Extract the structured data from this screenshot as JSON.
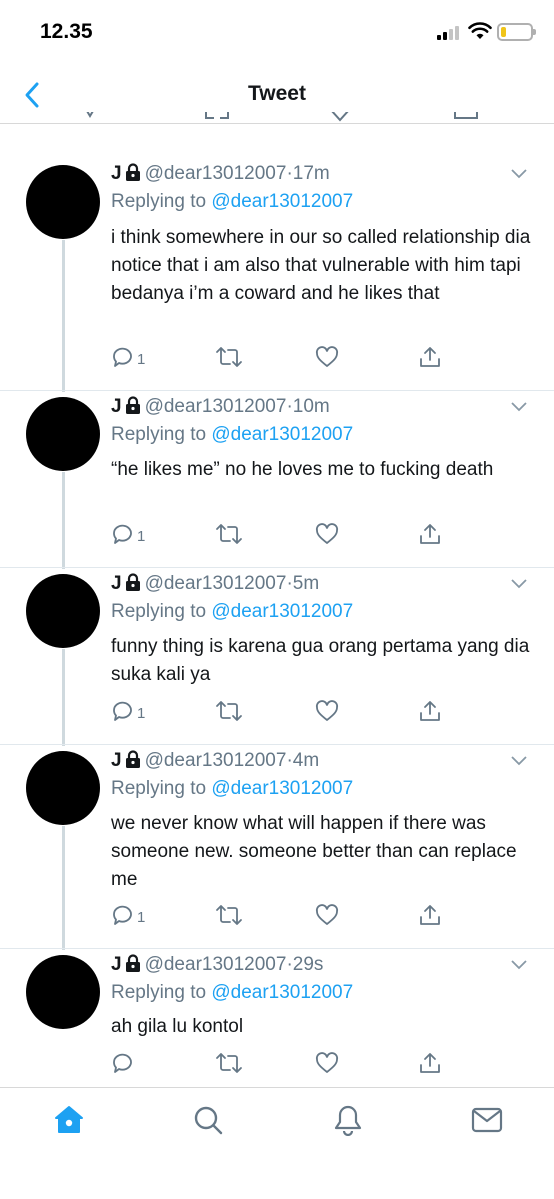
{
  "status_bar": {
    "time": "12.35",
    "battery_color": "#f0c419"
  },
  "header": {
    "title": "Tweet",
    "back_icon": "chevron-left-icon"
  },
  "colors": {
    "accent": "#1da1f2",
    "secondary_text": "#657786",
    "thread_line": "#cfd9de"
  },
  "tweets": [
    {
      "name": "J",
      "handle": "@dear13012007",
      "time": "17m",
      "replying_prefix": "Replying to",
      "replying_to": "@dear13012007",
      "text": "i think somewhere in our so called relationship dia notice that i am also that vulnerable with him tapi bedanya i’m a coward and he likes that",
      "reply_count": "1"
    },
    {
      "name": "J",
      "handle": "@dear13012007",
      "time": "10m",
      "replying_prefix": "Replying to",
      "replying_to": "@dear13012007",
      "text": "“he likes me” no he loves me to fucking death",
      "reply_count": "1"
    },
    {
      "name": "J",
      "handle": "@dear13012007",
      "time": "5m",
      "replying_prefix": "Replying to",
      "replying_to": "@dear13012007",
      "text": "funny thing is karena gua orang pertama yang dia suka kali ya",
      "reply_count": "1"
    },
    {
      "name": "J",
      "handle": "@dear13012007",
      "time": "4m",
      "replying_prefix": "Replying to",
      "replying_to": "@dear13012007",
      "text": "we never know what will happen if there was someone new. someone better than can replace me",
      "reply_count": "1"
    },
    {
      "name": "J",
      "handle": "@dear13012007",
      "time": "29s",
      "replying_prefix": "Replying to",
      "replying_to": "@dear13012007",
      "text": "ah gila lu kontol",
      "reply_count": ""
    }
  ],
  "tabbar": {
    "items": [
      "home-icon",
      "search-icon",
      "notifications-icon",
      "messages-icon"
    ],
    "active": "home-icon"
  }
}
